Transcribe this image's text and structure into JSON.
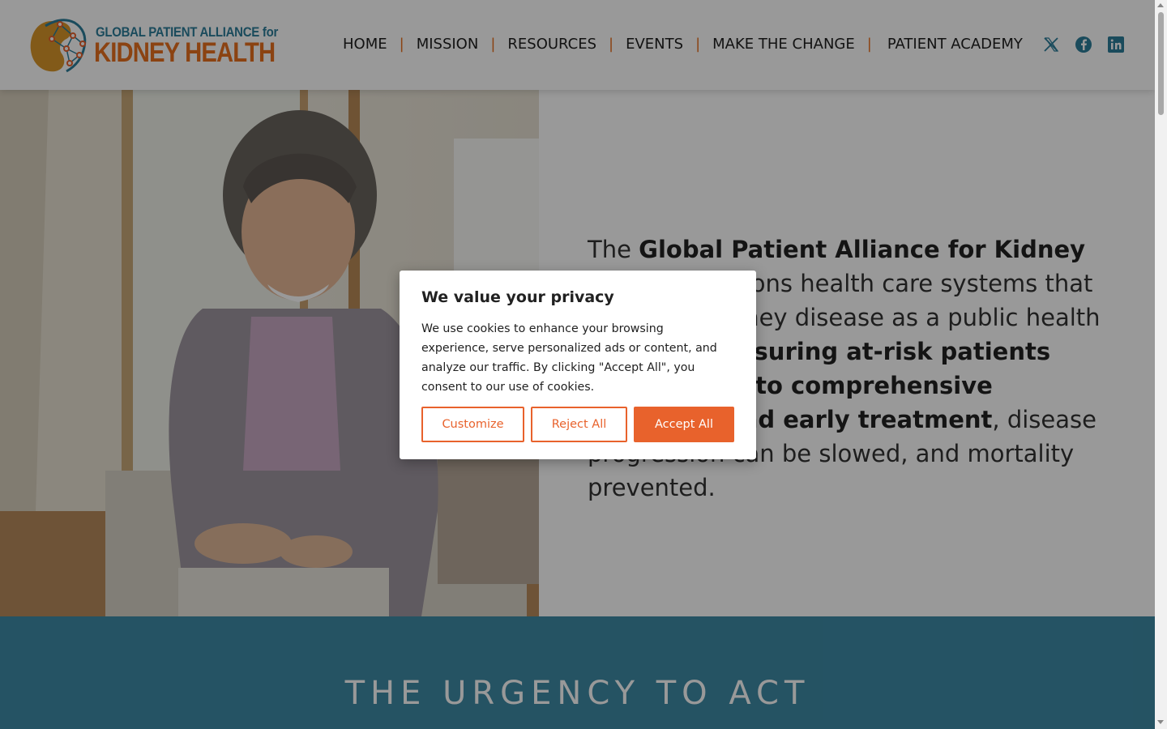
{
  "header": {
    "logo": {
      "line1": "GLOBAL PATIENT ALLIANCE for",
      "line2_part1": "KIDNEY",
      "line2_part2": "HEALTH"
    },
    "nav": [
      "HOME",
      "MISSION",
      "RESOURCES",
      "EVENTS",
      "MAKE THE CHANGE",
      "PATIENT ACADEMY"
    ],
    "social": [
      "x-icon",
      "facebook-icon",
      "linkedin-icon"
    ]
  },
  "hero": {
    "image": "smiling-elderly-woman-photo",
    "text_parts": [
      {
        "text": "The ",
        "bold": false
      },
      {
        "text": "Global Patient Alliance for Kidney Health",
        "bold": true
      },
      {
        "text": " envisions health care systems that recognize kidney disease as a public health priority. By ",
        "bold": false
      },
      {
        "text": "ensuring at-risk patients have access to comprehensive screening and early treatment",
        "bold": true
      },
      {
        "text": ", disease progression can be slowed, and mortality prevented.",
        "bold": false
      }
    ]
  },
  "band": {
    "title": "THE URGENCY TO ACT"
  },
  "cookie_modal": {
    "title": "We value your privacy",
    "body": "We use cookies to enhance your browsing experience, serve personalized ads or content, and analyze our traffic. By clicking \"Accept All\", you consent to our use of cookies.",
    "customize_label": "Customize",
    "reject_label": "Reject All",
    "accept_label": "Accept All"
  },
  "colors": {
    "accent": "#e8622c",
    "brand_blue": "#2c7d9a",
    "band": "#3e8aa6"
  }
}
